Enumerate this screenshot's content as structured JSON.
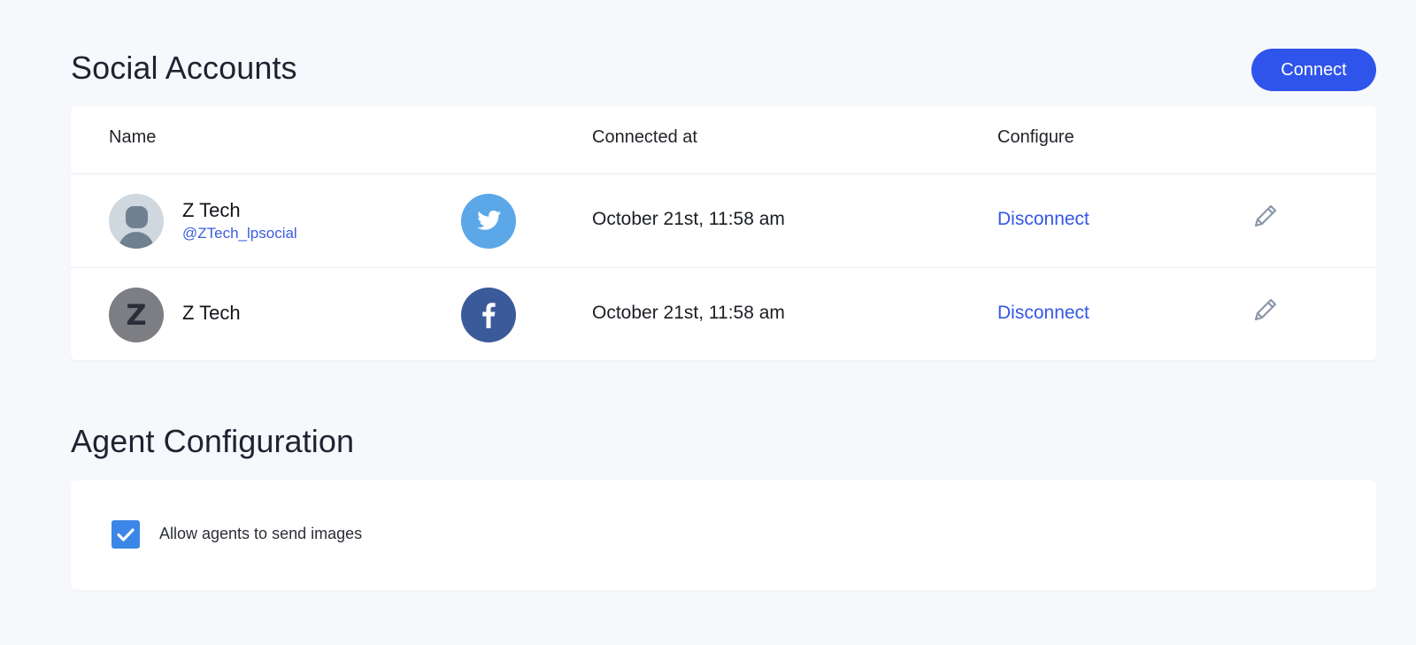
{
  "social": {
    "title": "Social Accounts",
    "connect_label": "Connect",
    "columns": {
      "name": "Name",
      "connected_at": "Connected at",
      "configure": "Configure"
    },
    "accounts": [
      {
        "name": "Z Tech",
        "handle": "@ZTech_lpsocial",
        "avatar": "person-placeholder-icon",
        "network": "twitter-icon",
        "connected_at": "October 21st, 11:58 am",
        "action": "Disconnect",
        "edit_icon": "pencil-icon"
      },
      {
        "name": "Z Tech",
        "avatar_letter": "Z",
        "network": "facebook-icon",
        "connected_at": "October 21st, 11:58 am",
        "action": "Disconnect",
        "edit_icon": "pencil-icon"
      }
    ]
  },
  "agent": {
    "title": "Agent Configuration",
    "allow_images_label": "Allow agents to send images",
    "allow_images_checked": true
  },
  "colors": {
    "accent": "#2f54eb",
    "link": "#3557e6",
    "twitter": "#5ba7e8",
    "facebook": "#3b5a9a",
    "checkbox": "#3b86e6",
    "page_background": "#f7f8fc"
  }
}
